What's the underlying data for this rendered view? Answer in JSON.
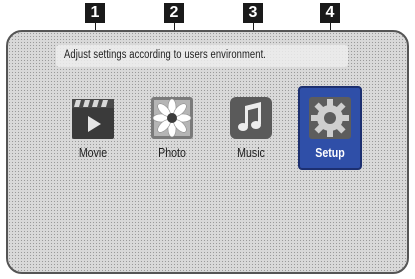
{
  "callouts": [
    "1",
    "2",
    "3",
    "4"
  ],
  "home_menu": {
    "caption": "Adjust settings according to users environment.",
    "items": [
      {
        "label": "Movie",
        "icon": "movie-clapperboard-icon"
      },
      {
        "label": "Photo",
        "icon": "photo-flower-icon"
      },
      {
        "label": "Music",
        "icon": "music-note-icon"
      },
      {
        "label": "Setup",
        "icon": "setup-gear-icon"
      }
    ],
    "selected_item": "Setup"
  },
  "colors": {
    "selected_highlight": "#2f4fa8",
    "callout_fill": "#1a1a1a",
    "screen_background": "#d9d9d9"
  }
}
